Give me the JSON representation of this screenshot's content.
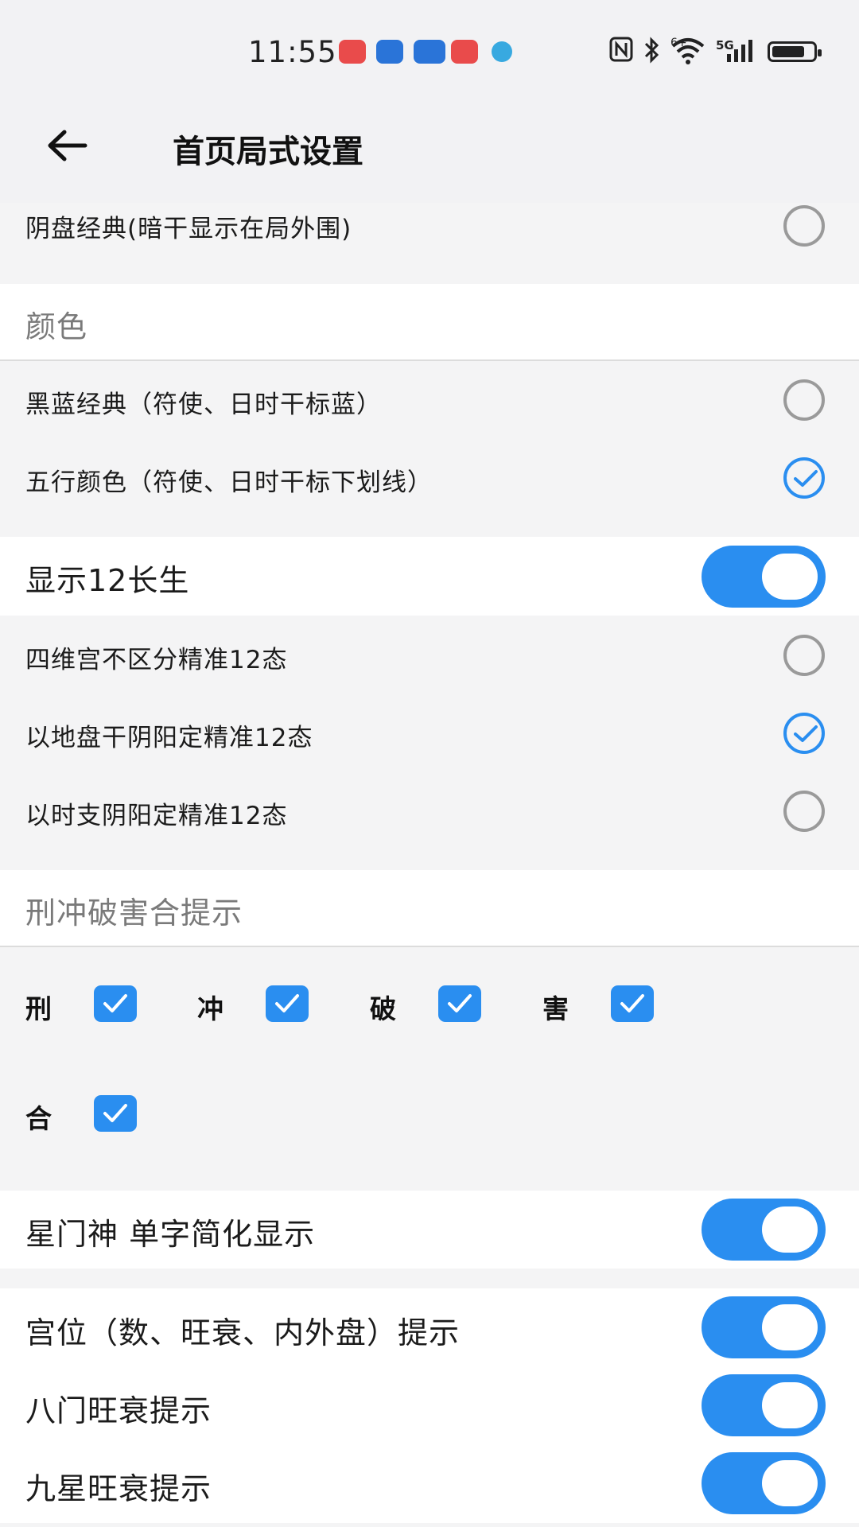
{
  "status_bar": {
    "time": "11:55",
    "icons": [
      "huawei-store-icon",
      "lightbulb-app-icon",
      "game-controller-icon",
      "huawei-store-icon",
      "browser-icon",
      "nfc-icon",
      "bluetooth-icon",
      "wifi-icon",
      "signal-5g-icon",
      "battery-icon"
    ],
    "wifi_badge": "6+",
    "network": "5G"
  },
  "header": {
    "title": "首页局式设置",
    "back_icon": "back-arrow-icon"
  },
  "layout_options": {
    "partial_item": "阴盘经典(暗干显示在局外围)",
    "partial_item_selected": false
  },
  "color_section": {
    "title": "颜色",
    "options": [
      {
        "label": "黑蓝经典（符使、日时干标蓝）",
        "selected": false
      },
      {
        "label": "五行颜色（符使、日时干标下划线）",
        "selected": true
      }
    ]
  },
  "changsheng": {
    "label": "显示12长生",
    "enabled": true,
    "options": [
      {
        "label": "四维宫不区分精准12态",
        "selected": false
      },
      {
        "label": "以地盘干阴阳定精准12态",
        "selected": true
      },
      {
        "label": "以时支阴阳定精准12态",
        "selected": false
      }
    ]
  },
  "hints_section": {
    "title": "刑冲破害合提示",
    "checks": [
      {
        "label": "刑",
        "checked": true
      },
      {
        "label": "冲",
        "checked": true
      },
      {
        "label": "破",
        "checked": true
      },
      {
        "label": "害",
        "checked": true
      },
      {
        "label": "合",
        "checked": true
      }
    ]
  },
  "toggles": [
    {
      "label": "星门神 单字简化显示",
      "enabled": true
    },
    {
      "label": "宫位（数、旺衰、内外盘）提示",
      "enabled": true
    },
    {
      "label": "八门旺衰提示",
      "enabled": true
    },
    {
      "label": "九星旺衰提示",
      "enabled": true
    }
  ],
  "colors": {
    "accent": "#2a8ef0",
    "background": "#f4f4f5",
    "section": "#ffffff"
  }
}
